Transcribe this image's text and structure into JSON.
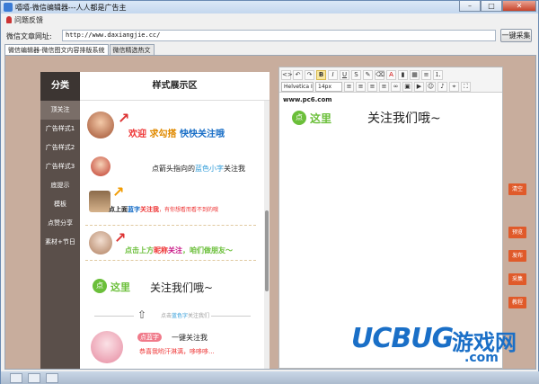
{
  "window": {
    "title": "嘻嘻-微信编辑器---人人都是广告主",
    "min_glyph": "–",
    "max_glyph": "□",
    "close_glyph": "✕"
  },
  "menu": {
    "feedback": "问题反馈"
  },
  "url_bar": {
    "label": "微信文章网址:",
    "value": "http://www.daxiangjie.cc/",
    "collect_button": "一键采集"
  },
  "tabs": [
    {
      "label": "微信编辑器-微信图文内容排版系统",
      "active": true
    },
    {
      "label": "微信精选热文",
      "active": false
    }
  ],
  "sidebar": {
    "heading": "分类",
    "items": [
      "顶关注",
      "广告样式1",
      "广告样式2",
      "广告样式3",
      "底提示",
      "模板",
      "点赞分享",
      "素材+节日"
    ]
  },
  "showcase": {
    "heading": "样式展示区",
    "card1": {
      "part1": "欢迎",
      "part2": "求勾搭",
      "part3": "快快关注哦"
    },
    "card2": {
      "prefix": "点箭头指向的",
      "highlight": "蓝色小字",
      "suffix": "关注我"
    },
    "card3": {
      "part1": "点上面",
      "part2": "蓝字",
      "part3": "关注我",
      "part4": "，有你想看而看不到的哦"
    },
    "card4": {
      "part1": "点击上方",
      "part2": "昵称",
      "part3": "关注",
      "part4": "，咱们做朋友～"
    },
    "card5": {
      "badge": "点",
      "here": "这里",
      "follow": "关注我们哦~"
    },
    "card6": {
      "prefix": "点击",
      "highlight": "蓝色字",
      "suffix": "关注我们"
    },
    "card7": {
      "tag": "点蓝字",
      "line1": "一键关注我",
      "line2": "恭喜我哟汗淋漓，哆哆哆..."
    }
  },
  "editor": {
    "toolbar": {
      "font_family": "Helvetica I",
      "font_size": "14px",
      "bold": "B",
      "italic": "I",
      "underline": "U",
      "font_color": "A"
    },
    "content": {
      "site": "www.pc6.com",
      "badge": "点",
      "here": "这里",
      "follow": "关注我们哦~"
    }
  },
  "actions": [
    "清空",
    "预览",
    "发布",
    "采集",
    "教程"
  ],
  "watermark": {
    "brand": "UCBUG",
    "game": "游戏网",
    "domain": ".com"
  },
  "colors": {
    "panel_bg": "#c8ad9d",
    "sidebar_bg": "#5a4f4a",
    "accent_red": "#e05a2a",
    "accent_green": "#6bbf3a",
    "link_blue": "#1a6fc7"
  }
}
